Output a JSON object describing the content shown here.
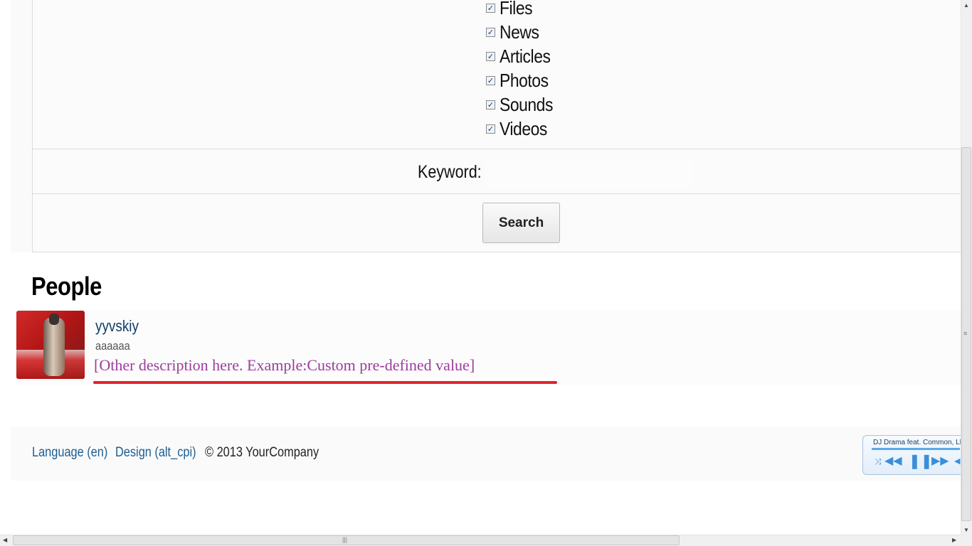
{
  "search_form": {
    "content_types": [
      {
        "label": "Files",
        "checked": true
      },
      {
        "label": "News",
        "checked": true
      },
      {
        "label": "Articles",
        "checked": true
      },
      {
        "label": "Photos",
        "checked": true
      },
      {
        "label": "Sounds",
        "checked": true
      },
      {
        "label": "Videos",
        "checked": true
      }
    ],
    "keyword_label": "Keyword:",
    "keyword_value": "",
    "search_button": "Search"
  },
  "people": {
    "title": "People",
    "items": [
      {
        "name": "yyvskiy",
        "subtitle": "aaaaaa",
        "description": "[Other description here. Example:Custom pre-defined value]"
      }
    ]
  },
  "footer": {
    "language_link": "Language (en)",
    "design_link": "Design (alt_cpi)",
    "copyright": "© 2013 YourCompany"
  },
  "media_player": {
    "track_title": "DJ Drama feat. Common, Llo",
    "controls": [
      "shuffle-icon",
      "previous-icon",
      "pause-icon",
      "next-icon",
      "volume-icon"
    ]
  },
  "colors": {
    "link": "#1d5d8f",
    "person_name": "#103d66",
    "description": "#9c3d9c",
    "highlight_underline": "#e2232c"
  }
}
